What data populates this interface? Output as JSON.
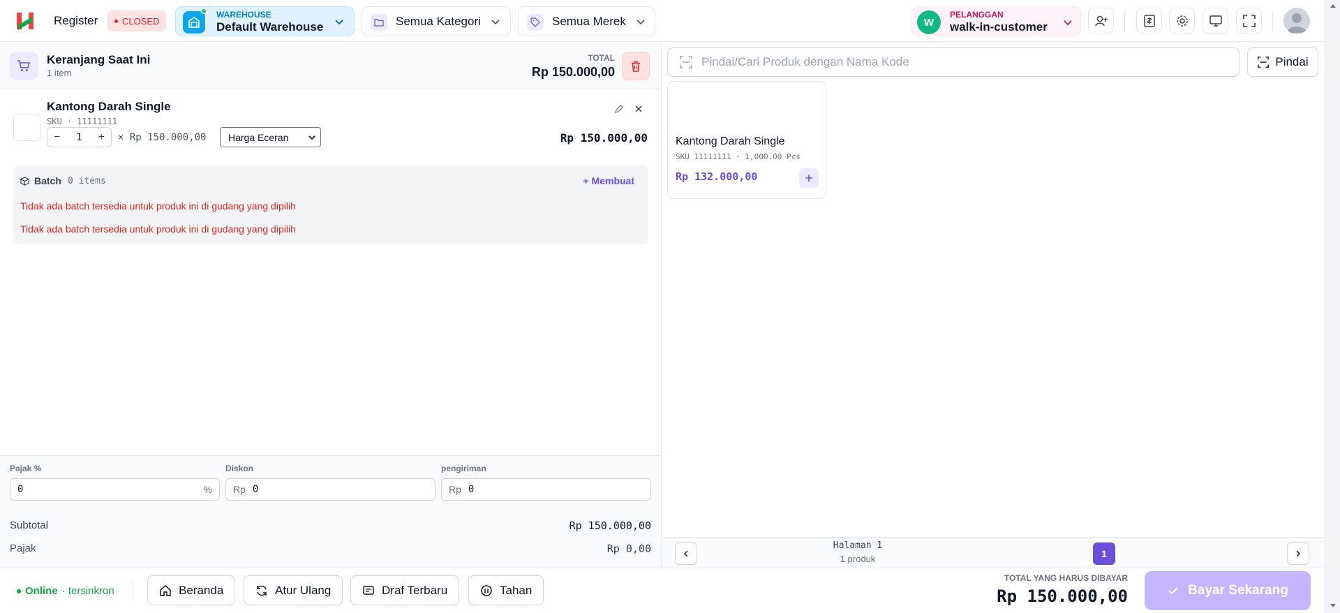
{
  "topbar": {
    "logo_alt": "app-logo",
    "register_label": "Register",
    "status_label": "CLOSED",
    "warehouse": {
      "caption": "WAREHOUSE",
      "name": "Default Warehouse"
    },
    "category_label": "Semua Kategori",
    "brand_label": "Semua Merek",
    "customer": {
      "initial": "W",
      "caption": "PELANGGAN",
      "name": "walk-in-customer"
    }
  },
  "cart": {
    "title": "Keranjang Saat Ini",
    "count": "1 item",
    "total_caption": "TOTAL",
    "total_value": "Rp 150.000,00",
    "item": {
      "name": "Kantong Darah Single",
      "sku": "SKU · 11111111",
      "qty": "1",
      "minus": "−",
      "plus": "+",
      "unit_price": "× Rp 150.000,00",
      "price_type": "Harga Eceran",
      "line_total": "Rp 150.000,00"
    },
    "batch": {
      "label": "Batch",
      "count": "0 items",
      "create_label": "+ Membuat",
      "warning_1": "Tidak ada batch tersedia untuk produk ini di gudang yang dipilih",
      "warning_2": "Tidak ada batch tersedia untuk produk ini di gudang yang dipilih"
    }
  },
  "adjustments": {
    "tax_label": "Pajak %",
    "tax_value": "0",
    "tax_suffix": "%",
    "discount_label": "Diskon",
    "discount_prefix": "Rp",
    "discount_value": "0",
    "shipping_label": "pengiriman",
    "shipping_prefix": "Rp",
    "shipping_value": "0"
  },
  "summary": {
    "subtotal_label": "Subtotal",
    "subtotal_value": "Rp 150.000,00",
    "tax_label": "Pajak",
    "tax_value": "Rp 0,00"
  },
  "search": {
    "placeholder": "Pindai/Cari Produk dengan Nama Kode",
    "scan_label": "Pindai"
  },
  "products": [
    {
      "name": "Kantong Darah Single",
      "meta": "SKU 11111111 · 1,000.00 Pcs",
      "price": "Rp 132.000,00"
    }
  ],
  "pagination": {
    "page_label": "Halaman 1",
    "count_label": "1 produk",
    "current": "1"
  },
  "bottom": {
    "status": "Online",
    "sync": "· tersinkron",
    "home_label": "Beranda",
    "reset_label": "Atur Ulang",
    "drafts_label": "Draf Terbaru",
    "hold_label": "Tahan",
    "due_caption": "TOTAL YANG HARUS DIBAYAR",
    "due_value": "Rp 150.000,00",
    "pay_label": "Bayar Sekarang"
  },
  "colors": {
    "accent": "#6d4ed8",
    "danger": "#dc2626",
    "warehouse_bg": "#e0f2fe",
    "customer_bg": "#fdf2f8",
    "pay_bg": "#c4b5fd",
    "online": "#16a34a"
  }
}
